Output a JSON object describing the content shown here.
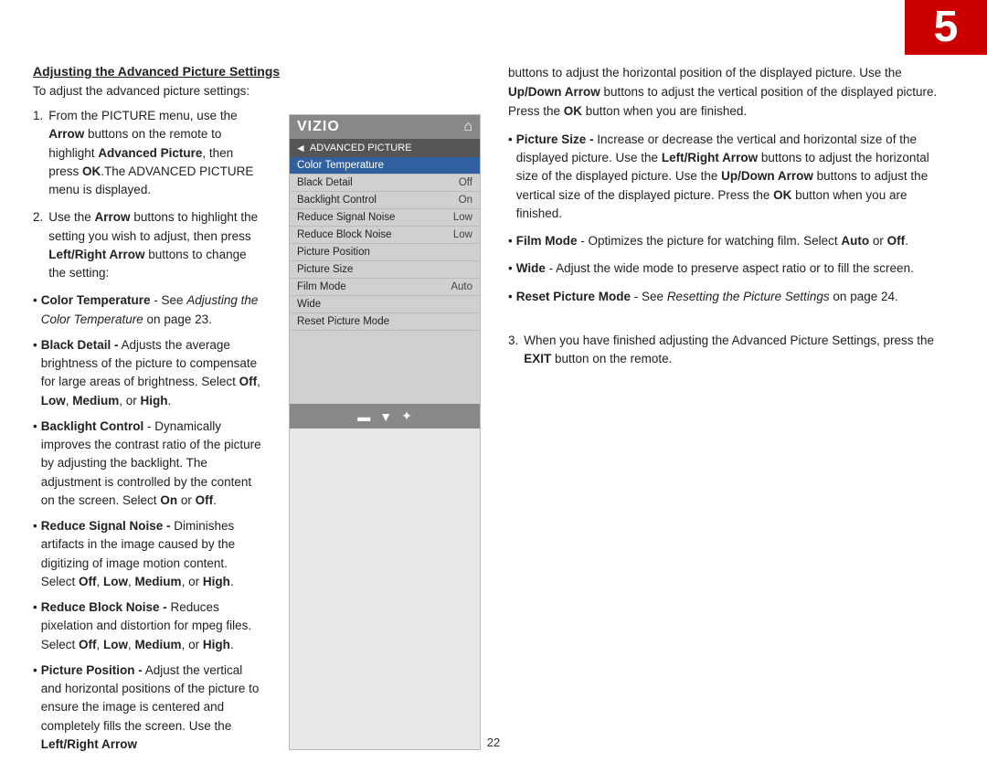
{
  "page": {
    "number": "5",
    "bottom_page_number": "22"
  },
  "header": {
    "title": "Adjusting the Advanced Picture Settings"
  },
  "left": {
    "intro": "To adjust the advanced picture settings:",
    "steps": [
      {
        "num": "1.",
        "text_parts": [
          {
            "text": "From the PICTURE menu, use the "
          },
          {
            "bold": "Arrow"
          },
          {
            "text": " buttons on the remote to highlight "
          },
          {
            "bold": "Advanced Picture"
          },
          {
            "text": ", then press "
          },
          {
            "bold": "OK"
          },
          {
            "text": ".The ADVANCED PICTURE menu is displayed."
          }
        ]
      },
      {
        "num": "2.",
        "text_parts": [
          {
            "text": "Use the "
          },
          {
            "bold": "Arrow"
          },
          {
            "text": " buttons to highlight the setting you wish to adjust, then press "
          },
          {
            "bold": "Left/Right Arrow"
          },
          {
            "text": " buttons to change the setting:"
          }
        ]
      }
    ],
    "bullets": [
      {
        "label": "Color Temperature",
        "desc_parts": [
          {
            "text": " - See "
          },
          {
            "italic": "Adjusting the Color Temperature"
          },
          {
            "text": " on page 23."
          }
        ]
      },
      {
        "label": "Black Detail -",
        "desc": " Adjusts the average brightness of the picture to compensate for large areas of brightness. Select ",
        "options": [
          "Off",
          "Low",
          "Medium"
        ],
        "or_text": ", or ",
        "last_bold": "High",
        "last_period": "."
      },
      {
        "label": "Backlight Control",
        "desc": " - Dynamically improves the contrast ratio of the picture by adjusting the backlight. The adjustment is controlled by the content on the screen. Select ",
        "on_off": [
          "On",
          "Off"
        ],
        "or_text": " or ",
        "last_period": "."
      },
      {
        "label": "Reduce Signal Noise -",
        "desc": " Diminishes artifacts in the image caused by the digitizing of image motion content. Select ",
        "options_inline": "Off, Low, Medium, or High",
        "options_bold": [
          "Off",
          "Low",
          "Medium"
        ],
        "last_bold": "High",
        "last_period": "."
      },
      {
        "label": "Reduce Block Noise -",
        "desc": " Reduces pixelation and distortion for mpeg files. Select ",
        "options_bold": [
          "Off",
          "Low",
          "Medium"
        ],
        "or_text": ", or ",
        "last_bold": "High",
        "last_period": "."
      },
      {
        "label": "Picture Position -",
        "desc": " Adjust the vertical and horizontal positions of the picture to ensure the image is centered and completely fills the screen. Use the ",
        "last_bold": "Left/Right Arrow"
      }
    ]
  },
  "tv_menu": {
    "logo": "VIZIO",
    "menu_title": "ADVANCED PICTURE",
    "items": [
      {
        "label": "Color Temperature",
        "value": "",
        "highlighted": true
      },
      {
        "label": "Black Detail",
        "value": "Off"
      },
      {
        "label": "Backlight Control",
        "value": "On"
      },
      {
        "label": "Reduce Signal Noise",
        "value": "Low"
      },
      {
        "label": "Reduce Block Noise",
        "value": "Low"
      },
      {
        "label": "Picture Position",
        "value": ""
      },
      {
        "label": "Picture Size",
        "value": ""
      },
      {
        "label": "Film Mode",
        "value": "Auto"
      },
      {
        "label": "Wide",
        "value": ""
      },
      {
        "label": "Reset Picture Mode",
        "value": ""
      }
    ]
  },
  "right": {
    "intro": "buttons to adjust the horizontal position of the displayed picture. Use the ",
    "intro_bold1": "Up/Down Arrow",
    "intro2": " buttons to adjust the vertical position of the displayed picture. Press the ",
    "intro_bold2": "OK",
    "intro3": " button when you are finished.",
    "bullets": [
      {
        "label": "Picture Size -",
        "desc": " Increase or decrease the vertical and horizontal size of the displayed picture. Use the ",
        "bold1": "Left/Right Arrow",
        "desc2": " buttons to adjust the horizontal size of the displayed picture. Use the ",
        "bold2": "Up/Down Arrow",
        "desc3": " buttons to adjust the vertical size of the displayed picture. Press the ",
        "bold3": "OK",
        "desc4": " button when you are finished."
      },
      {
        "label": "Film Mode",
        "desc": " - Optimizes the picture for watching film. Select ",
        "bold1": "Auto",
        "or": " or ",
        "bold2": "Off",
        "period": "."
      },
      {
        "label": "Wide",
        "desc": " - Adjust the wide mode to preserve aspect ratio or to fill the screen."
      },
      {
        "label": "Reset Picture Mode",
        "desc": " - See ",
        "italic": "Resetting the Picture Settings",
        "desc2": " on page 24."
      }
    ],
    "step3": {
      "num": "3.",
      "text1": "When you have finished adjusting the Advanced Picture Settings, press the ",
      "bold": "EXIT",
      "text2": " button on the remote."
    }
  }
}
